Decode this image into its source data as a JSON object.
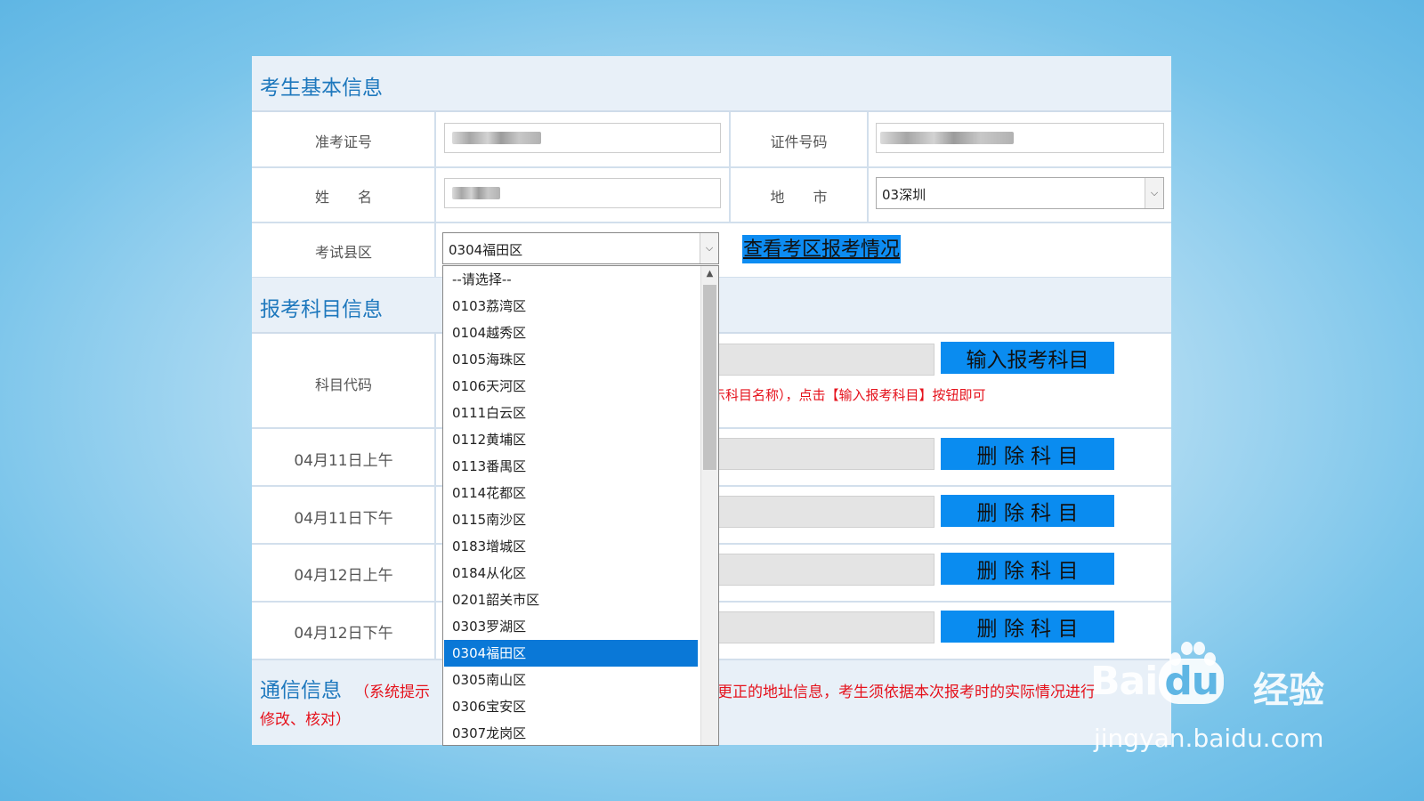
{
  "sections": {
    "basic_info_title": "考生基本信息",
    "subject_info_title": "报考科目信息",
    "contact_title": "通信信息"
  },
  "basic": {
    "admission_label": "准考证号",
    "id_label": "证件号码",
    "name_label": "姓　　名",
    "city_label": "地　　市",
    "city_value": "03深圳",
    "district_label": "考试县区",
    "district_value": "0304福田区",
    "view_link": "查看考区报考情况"
  },
  "subjects": {
    "code_label": "科目代码",
    "input_button": "输入报考科目",
    "hint": "示科目名称），点击【输入报考科目】按钮即可",
    "sessions": [
      {
        "label": "04月11日上午",
        "button": "删 除 科 目"
      },
      {
        "label": "04月11日下午",
        "button": "删 除 科 目"
      },
      {
        "label": "04月12日上午",
        "button": "删 除 科 目"
      },
      {
        "label": "04月12日下午",
        "button": "删 除 科 目"
      }
    ]
  },
  "contact": {
    "hint_left": "（系统提示",
    "hint_right": "更正的地址信息，考生须依据本次报考时的实际情况进行",
    "hint_line2": "修改、核对）"
  },
  "dropdown": {
    "options": [
      "--请选择--",
      "0103荔湾区",
      "0104越秀区",
      "0105海珠区",
      "0106天河区",
      "0111白云区",
      "0112黄埔区",
      "0113番禺区",
      "0114花都区",
      "0115南沙区",
      "0183增城区",
      "0184从化区",
      "0201韶关市区",
      "0303罗湖区",
      "0304福田区",
      "0305南山区",
      "0306宝安区",
      "0307龙岗区"
    ],
    "selected_index": 14
  },
  "watermark": {
    "brand_bai": "Bai",
    "brand_du": "du",
    "brand_jingyan": "经验",
    "url": "jingyan.baidu.com"
  },
  "colors": {
    "accent": "#0a8cf0",
    "title_text": "#1e78bd",
    "hint_text": "#e5121c",
    "selected_option": "#0a78d7"
  }
}
